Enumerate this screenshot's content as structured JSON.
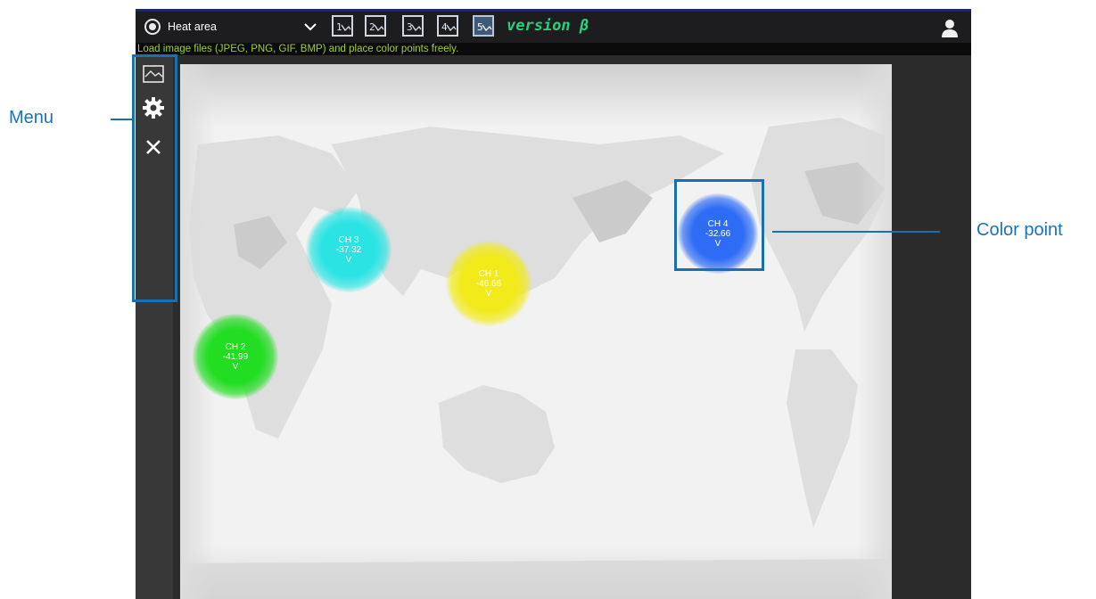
{
  "header": {
    "mode_label": "Heat area",
    "layout_buttons": [
      {
        "label": "1",
        "active": false
      },
      {
        "label": "2",
        "active": false
      },
      {
        "label": "3",
        "active": false
      },
      {
        "label": "4",
        "active": false
      },
      {
        "label": "5",
        "active": true
      }
    ],
    "version": "version β",
    "icons": {
      "mode": "radio-target-icon",
      "dropdown": "chevron-down-icon",
      "user": "user-icon"
    }
  },
  "hint": "Load image files (JPEG, PNG, GIF, BMP) and place color points freely.",
  "sidebar": {
    "items": [
      {
        "name": "load-image-button",
        "icon": "image-icon"
      },
      {
        "name": "settings-button",
        "icon": "gear-icon"
      },
      {
        "name": "close-button",
        "icon": "close-icon"
      }
    ]
  },
  "color_points": [
    {
      "label": "CH 1",
      "value": "-46.66",
      "unit": "V",
      "color": "#f2ea1a"
    },
    {
      "label": "CH 2",
      "value": "-41.99",
      "unit": "V",
      "color": "#22dd22"
    },
    {
      "label": "CH 3",
      "value": "-37.32",
      "unit": "V",
      "color": "#2ce3e3"
    },
    {
      "label": "CH 4",
      "value": "-32.66",
      "unit": "V",
      "color": "#2f6cf5"
    }
  ],
  "annotations": {
    "menu": "Menu",
    "color_point": "Color point"
  },
  "colors": {
    "annotation": "#1a6fb0",
    "version_text": "#27d07a",
    "hint_text": "#9ecf3a"
  }
}
